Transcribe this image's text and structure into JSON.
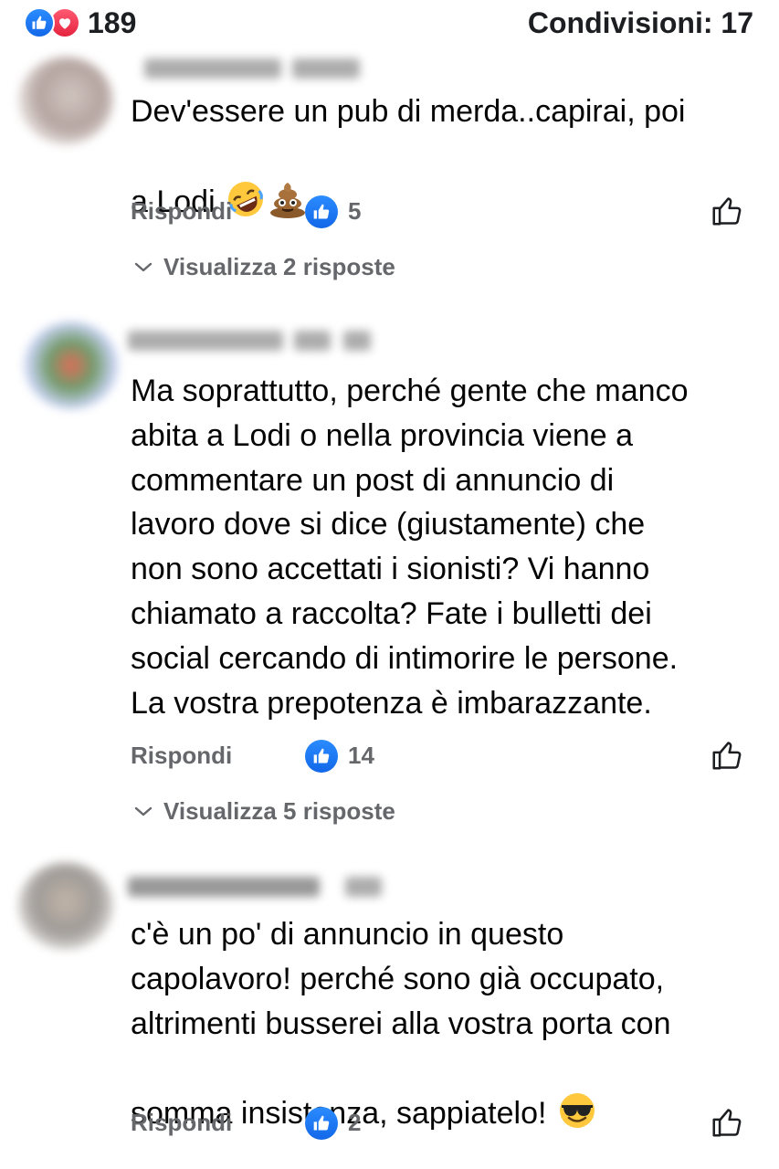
{
  "header": {
    "reaction_count": "189",
    "shares_label": "Condivisioni: 17"
  },
  "colors": {
    "like_blue": "#1877f2",
    "love_red": "#f02849",
    "secondary_text": "#65676b"
  },
  "comments": [
    {
      "text_line1": "Dev'essere un pub di merda..capirai, poi",
      "text_line2": "a Lodi",
      "emojis": [
        "rolling-on-floor-laughing-emoji",
        "pile-of-poo-emoji"
      ],
      "reply_label": "Rispondi",
      "like_count": "5",
      "view_replies": "Visualizza 2 risposte"
    },
    {
      "text": "Ma soprattutto, perché gente che manco\nabita a Lodi o nella provincia viene a\ncommentare un post di annuncio di\nlavoro dove si dice (giustamente) che\nnon sono accettati i sionisti? Vi hanno\nchiamato a raccolta? Fate i bulletti dei\nsocial cercando di intimorire le persone.\nLa vostra prepotenza è imbarazzante.",
      "reply_label": "Rispondi",
      "like_count": "14",
      "view_replies": "Visualizza 5 risposte"
    },
    {
      "text_main": "c'è un po' di annuncio in questo\ncapolavoro! perché sono già occupato,\naltrimenti busserei alla vostra porta con\n",
      "text_last": "somma insistenza, sappiatelo!",
      "emojis": [
        "smiling-face-with-sunglasses-emoji"
      ],
      "reply_label": "Rispondi",
      "like_count": "2"
    }
  ]
}
